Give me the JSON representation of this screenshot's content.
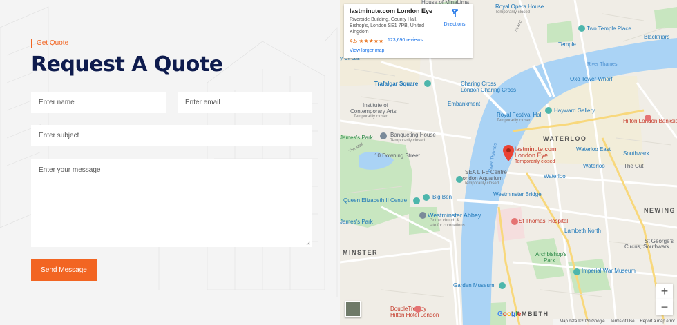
{
  "form": {
    "subtitle": "Get Quote",
    "title": "Request A Quote",
    "name_placeholder": "Enter name",
    "email_placeholder": "Enter email",
    "subject_placeholder": "Enter subject",
    "message_placeholder": "Enter your message",
    "submit_label": "Send Message",
    "accent_color": "#f26522",
    "title_color": "#0e1b4d"
  },
  "map": {
    "info_card": {
      "name": "lastminute.com London Eye",
      "address": "Riverside Building, County Hall, Bishop's, London SE1 7PB, United Kingdom",
      "rating": "4.5",
      "stars": "★★★★★",
      "reviews": "123,690 reviews",
      "directions_label": "Directions",
      "view_larger_label": "View larger map"
    },
    "pin": {
      "name_line1": "lastminute.com",
      "name_line2": "London Eye",
      "status": "Temporarily closed"
    },
    "labels": {
      "house_minalima": "House of MinaLima",
      "royal_opera": "Royal Opera House",
      "temp_closed_1": "Temporarily closed",
      "two_temple": "Two Temple Place",
      "blackfriars": "Blackfriars",
      "temple": "Temple",
      "strand": "Strand",
      "circus": "y Circus",
      "river_thames_top": "River Thames",
      "oxo_tower": "Oxo Tower Wharf",
      "trafalgar": "Trafalgar Square",
      "charing_cross_1": "Charing Cross",
      "charing_cross_2": "London Charing Cross",
      "institute_1": "Institute of",
      "institute_2": "Contemporary Arts",
      "temp_closed_2": "Temporarily closed",
      "embankment": "Embankment",
      "royal_festival": "Royal Festival Hall",
      "temp_closed_3": "Temporarily closed",
      "hayward": "Hayward Gallery",
      "hilton_bankside": "Hilton London Bankside",
      "banqueting_1": "Banqueting House",
      "banqueting_2": "Temporarily closed",
      "james_park": "James's Park",
      "the_mall": "The Mall",
      "waterloo_area": "WATERLOO",
      "waterloo_east": "Waterloo East",
      "southwark": "Southwark",
      "waterloo_1": "Waterloo",
      "waterloo_2": "Waterloo",
      "the_cut": "The Cut",
      "downing": "10 Downing Street",
      "sea_life_1": "SEA LIFE Centre",
      "sea_life_2": "London Aquarium",
      "sea_life_3": "Temporarily closed",
      "queen_elizabeth": "Queen Elizabeth II Centre",
      "big_ben": "Big Ben",
      "westminster_bridge": "Westminster Bridge",
      "newington": "NEWING",
      "james_park_2": "James's Park",
      "westminster_abbey": "Westminster Abbey",
      "abbey_sub1": "Gothic church &",
      "abbey_sub2": "site for coronations",
      "st_thomas": "St Thomas' Hospital",
      "lambeth_north": "Lambeth North",
      "st_georges": "St George's",
      "circus_southwark": "Circus, Southwark",
      "westminster_area": "MINSTER",
      "archbishops_1": "Archbishop's",
      "archbishops_2": "Park",
      "imperial_war": "Imperial War Museum",
      "garden_museum": "Garden Museum",
      "doubletree_1": "DoubleTree by",
      "doubletree_2": "Hilton Hotel London",
      "lambeth_area": "LAMBETH",
      "river_thames_mid": "River Thames"
    },
    "zoom_in": "+",
    "zoom_out": "−",
    "google_logo": "Google",
    "footer": {
      "map_data": "Map data ©2020 Google",
      "terms": "Terms of Use",
      "report": "Report a map error"
    }
  }
}
